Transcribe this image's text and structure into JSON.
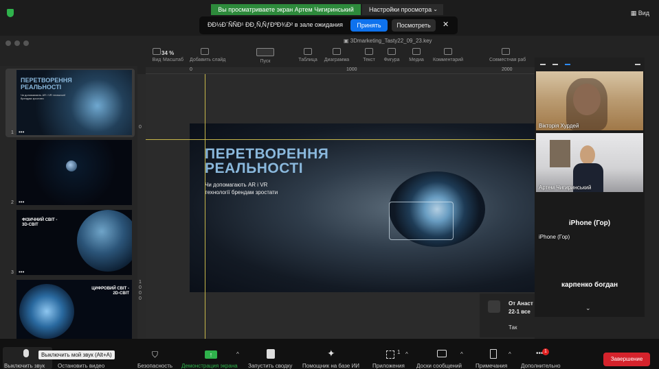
{
  "zoom_top": {
    "share_banner": "Вы просматриваете экран Артем Чигиринський",
    "view_options": "Настройки просмотра",
    "view_button": "Вид",
    "waiting_room_msg": "ÐÐ½Ð´ÑÑÐ¹ ÐÐ¸Ñ‚ÑƒÐºÐ¾Ð² в зале ожидания",
    "accept": "Принять",
    "see": "Посмотреть"
  },
  "keynote": {
    "file_title": "3Dmarketing_Tasty22_09_23.key",
    "zoom": "34 %",
    "toolbar": [
      {
        "label": "Вид",
        "icon": "sidebar-icon"
      },
      {
        "label": "Масштаб",
        "icon": "zoom-icon"
      },
      {
        "label": "Добавить слайд",
        "icon": "add-slide-icon"
      },
      {
        "label": "Пуск",
        "icon": "play-icon"
      },
      {
        "label": "Таблица",
        "icon": "table-icon"
      },
      {
        "label": "Диаграмма",
        "icon": "chart-icon"
      },
      {
        "label": "Текст",
        "icon": "text-icon"
      },
      {
        "label": "Фигура",
        "icon": "shape-icon"
      },
      {
        "label": "Медиа",
        "icon": "media-icon"
      },
      {
        "label": "Комментарий",
        "icon": "comment-icon"
      },
      {
        "label": "Совместная раб",
        "icon": "collab-icon"
      }
    ],
    "ruler_marks": [
      "0",
      "1000",
      "2000"
    ],
    "vruler_marks": [
      "0",
      "1",
      "0",
      "0",
      "0"
    ],
    "slides": [
      {
        "num": "1",
        "title": "ПЕРЕТВОРЕННЯ РЕАЛЬНОСТІ",
        "sub": "Чи допомагають AR і VR технології брендам зростати"
      },
      {
        "num": "2",
        "title": "",
        "sub": ""
      },
      {
        "num": "3",
        "title": "ФІЗИЧНИЙ СВІТ - 3D-СВІТ",
        "sub": ""
      },
      {
        "num": "4",
        "title": "ЦИФРОВИЙ СВІТ - 2D-СВІТ",
        "sub": ""
      }
    ],
    "main_slide": {
      "title_line1": "ПЕРЕТВОРЕННЯ",
      "title_line2": "РЕАЛЬНОСТІ",
      "subtitle_line1": "Чи допомагають AR і VR",
      "subtitle_line2": "технології брендам зростати"
    }
  },
  "participants": [
    {
      "name": "Вікторія Хурдей"
    },
    {
      "name": "Артем Чигиринський"
    },
    {
      "name": "iPhone (Гор)",
      "label": "iPhone (Гор)"
    },
    {
      "name": "карпенко богдан"
    }
  ],
  "chat": {
    "from": "От Анаст",
    "to": "22-1 все",
    "body": "Так"
  },
  "bottom_bar": {
    "mute": "Выключить звук",
    "mute_tooltip": "Выключить мой звук (Alt+A)",
    "stop_video": "Остановить видео",
    "security": "Безопасность",
    "share": "Демонстрация экрана",
    "summary": "Запустить сводку",
    "ai": "Помощник на базе ИИ",
    "apps": "Приложения",
    "apps_count": "1",
    "whiteboards": "Доски сообщений",
    "notes": "Примечания",
    "more": "Дополнительно",
    "more_badge": "1",
    "end": "Завершение"
  },
  "colors": {
    "accent_green": "#2fb24c",
    "accept_blue": "#0e72ed",
    "end_red": "#d5232c",
    "guide_yellow": "#c8b84a",
    "slide_title_blue": "#8ab8dc"
  }
}
